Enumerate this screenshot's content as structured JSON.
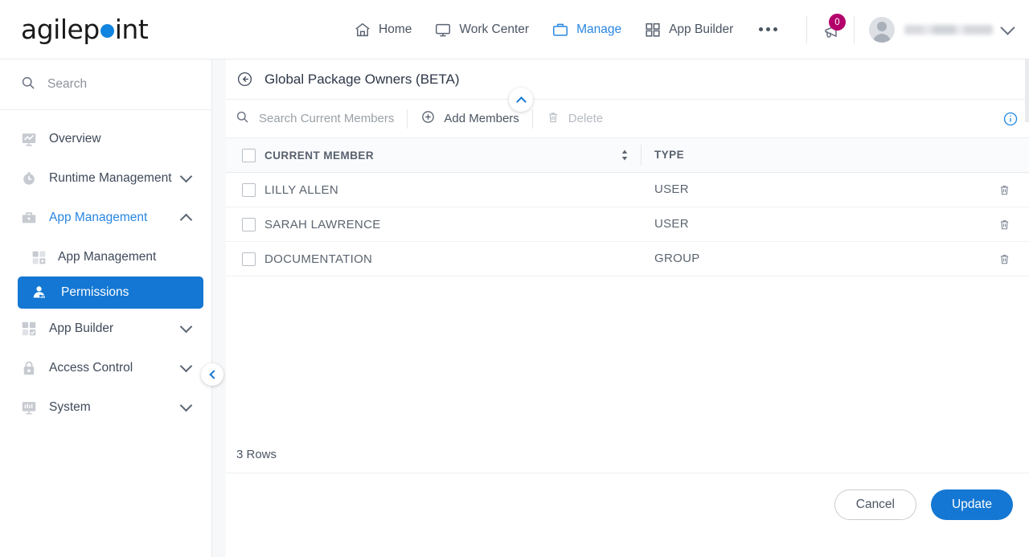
{
  "header": {
    "logo": {
      "text_before": "agilep",
      "dot": "o",
      "text_after": "int",
      "dot_color": "#1184e0"
    },
    "nav": [
      {
        "label": "Home",
        "icon": "home-icon",
        "active": false
      },
      {
        "label": "Work Center",
        "icon": "monitor-icon",
        "active": false
      },
      {
        "label": "Manage",
        "icon": "briefcase-icon",
        "active": true
      },
      {
        "label": "App Builder",
        "icon": "grid-icon",
        "active": false
      }
    ],
    "overflow_label": "•••",
    "announcements": {
      "icon": "megaphone-icon",
      "badge_count": "0",
      "badge_color": "#b3006b"
    },
    "user": {
      "icon": "avatar-icon",
      "name": "",
      "chevron": "chevron-down-icon"
    }
  },
  "sidebar": {
    "search": {
      "placeholder": "Search",
      "icon": "search-icon"
    },
    "items": [
      {
        "label": "Overview",
        "icon": "overview-icon",
        "expandable": false,
        "state": ""
      },
      {
        "label": "Runtime Management",
        "icon": "clock-icon",
        "expandable": true,
        "state": "collapsed"
      },
      {
        "label": "App Management",
        "icon": "briefcase-icon",
        "expandable": true,
        "state": "expanded"
      },
      {
        "label": "App Management",
        "icon": "apps-icon",
        "sub": true
      },
      {
        "label": "Permissions",
        "icon": "user-permission-icon",
        "selected": true
      },
      {
        "label": "App Builder",
        "icon": "grid-check-icon",
        "expandable": true,
        "state": "collapsed"
      },
      {
        "label": "Access Control",
        "icon": "lock-icon",
        "expandable": true,
        "state": "collapsed"
      },
      {
        "label": "System",
        "icon": "system-icon",
        "expandable": true,
        "state": "collapsed"
      }
    ],
    "collapse_handle": "chevron-left-icon"
  },
  "panel": {
    "back_icon": "back-arrow-icon",
    "title": "Global Package Owners (BETA)",
    "collapse_toggle_icon": "chevron-up-icon",
    "toolbar": {
      "search_placeholder": "Search Current Members",
      "search_icon": "search-icon",
      "add_label": "Add Members",
      "add_icon": "plus-circle-icon",
      "delete_label": "Delete",
      "delete_icon": "trash-icon",
      "delete_disabled": true,
      "info_icon": "info-icon"
    },
    "table": {
      "columns": [
        {
          "key": "member",
          "label": "CURRENT MEMBER",
          "sortable": true
        },
        {
          "key": "type",
          "label": "TYPE",
          "sortable": false
        }
      ],
      "rows": [
        {
          "member": "LILLY ALLEN",
          "type": "USER",
          "checked": false,
          "row_action_icon": "trash-icon"
        },
        {
          "member": "SARAH LAWRENCE",
          "type": "USER",
          "checked": false,
          "row_action_icon": "trash-icon"
        },
        {
          "member": "DOCUMENTATION",
          "type": "GROUP",
          "checked": false,
          "row_action_icon": "trash-icon"
        }
      ],
      "select_all_checked": false,
      "row_count_label": "3 Rows"
    },
    "footer": {
      "cancel_label": "Cancel",
      "update_label": "Update",
      "primary_color": "#1477d3"
    }
  }
}
